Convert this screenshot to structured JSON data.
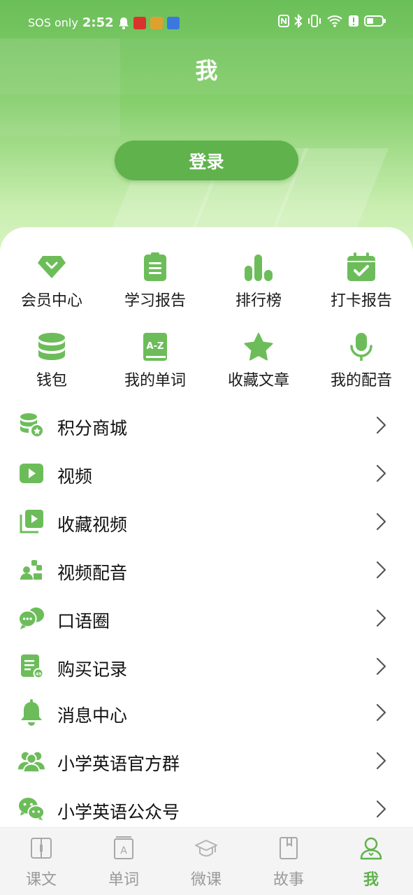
{
  "status_bar": {
    "carrier": "SOS only",
    "time": "2:52",
    "badge_colors": [
      "#d9342b",
      "#e0a030",
      "#3a78e0"
    ]
  },
  "header": {
    "title": "我",
    "login_label": "登录"
  },
  "colors": {
    "accent": "#5fb24c",
    "icon": "#6cbd5a",
    "inactive": "#9a9a9a"
  },
  "grid": [
    {
      "label": "会员中心",
      "icon": "diamond-icon"
    },
    {
      "label": "学习报告",
      "icon": "report-icon"
    },
    {
      "label": "排行榜",
      "icon": "bar-chart-icon"
    },
    {
      "label": "打卡报告",
      "icon": "calendar-check-icon"
    },
    {
      "label": "钱包",
      "icon": "coins-icon"
    },
    {
      "label": "我的单词",
      "icon": "az-book-icon"
    },
    {
      "label": "收藏文章",
      "icon": "star-icon"
    },
    {
      "label": "我的配音",
      "icon": "microphone-icon"
    }
  ],
  "menu": [
    {
      "label": "积分商城",
      "icon": "points-coins-icon"
    },
    {
      "label": "视频",
      "icon": "play-icon"
    },
    {
      "label": "收藏视频",
      "icon": "video-collection-icon"
    },
    {
      "label": "视频配音",
      "icon": "dubbing-icon"
    },
    {
      "label": "口语圈",
      "icon": "chat-bubbles-icon"
    },
    {
      "label": "购买记录",
      "icon": "purchase-record-icon"
    },
    {
      "label": "消息中心",
      "icon": "bell-icon"
    },
    {
      "label": "小学英语官方群",
      "icon": "group-icon"
    },
    {
      "label": "小学英语公众号",
      "icon": "wechat-icon"
    }
  ],
  "tabs": [
    {
      "label": "课文",
      "icon": "book-open-icon",
      "active": false
    },
    {
      "label": "单词",
      "icon": "letter-card-icon",
      "active": false
    },
    {
      "label": "微课",
      "icon": "grad-cap-icon",
      "active": false
    },
    {
      "label": "故事",
      "icon": "bookmark-book-icon",
      "active": false
    },
    {
      "label": "我",
      "icon": "person-icon",
      "active": true
    }
  ]
}
